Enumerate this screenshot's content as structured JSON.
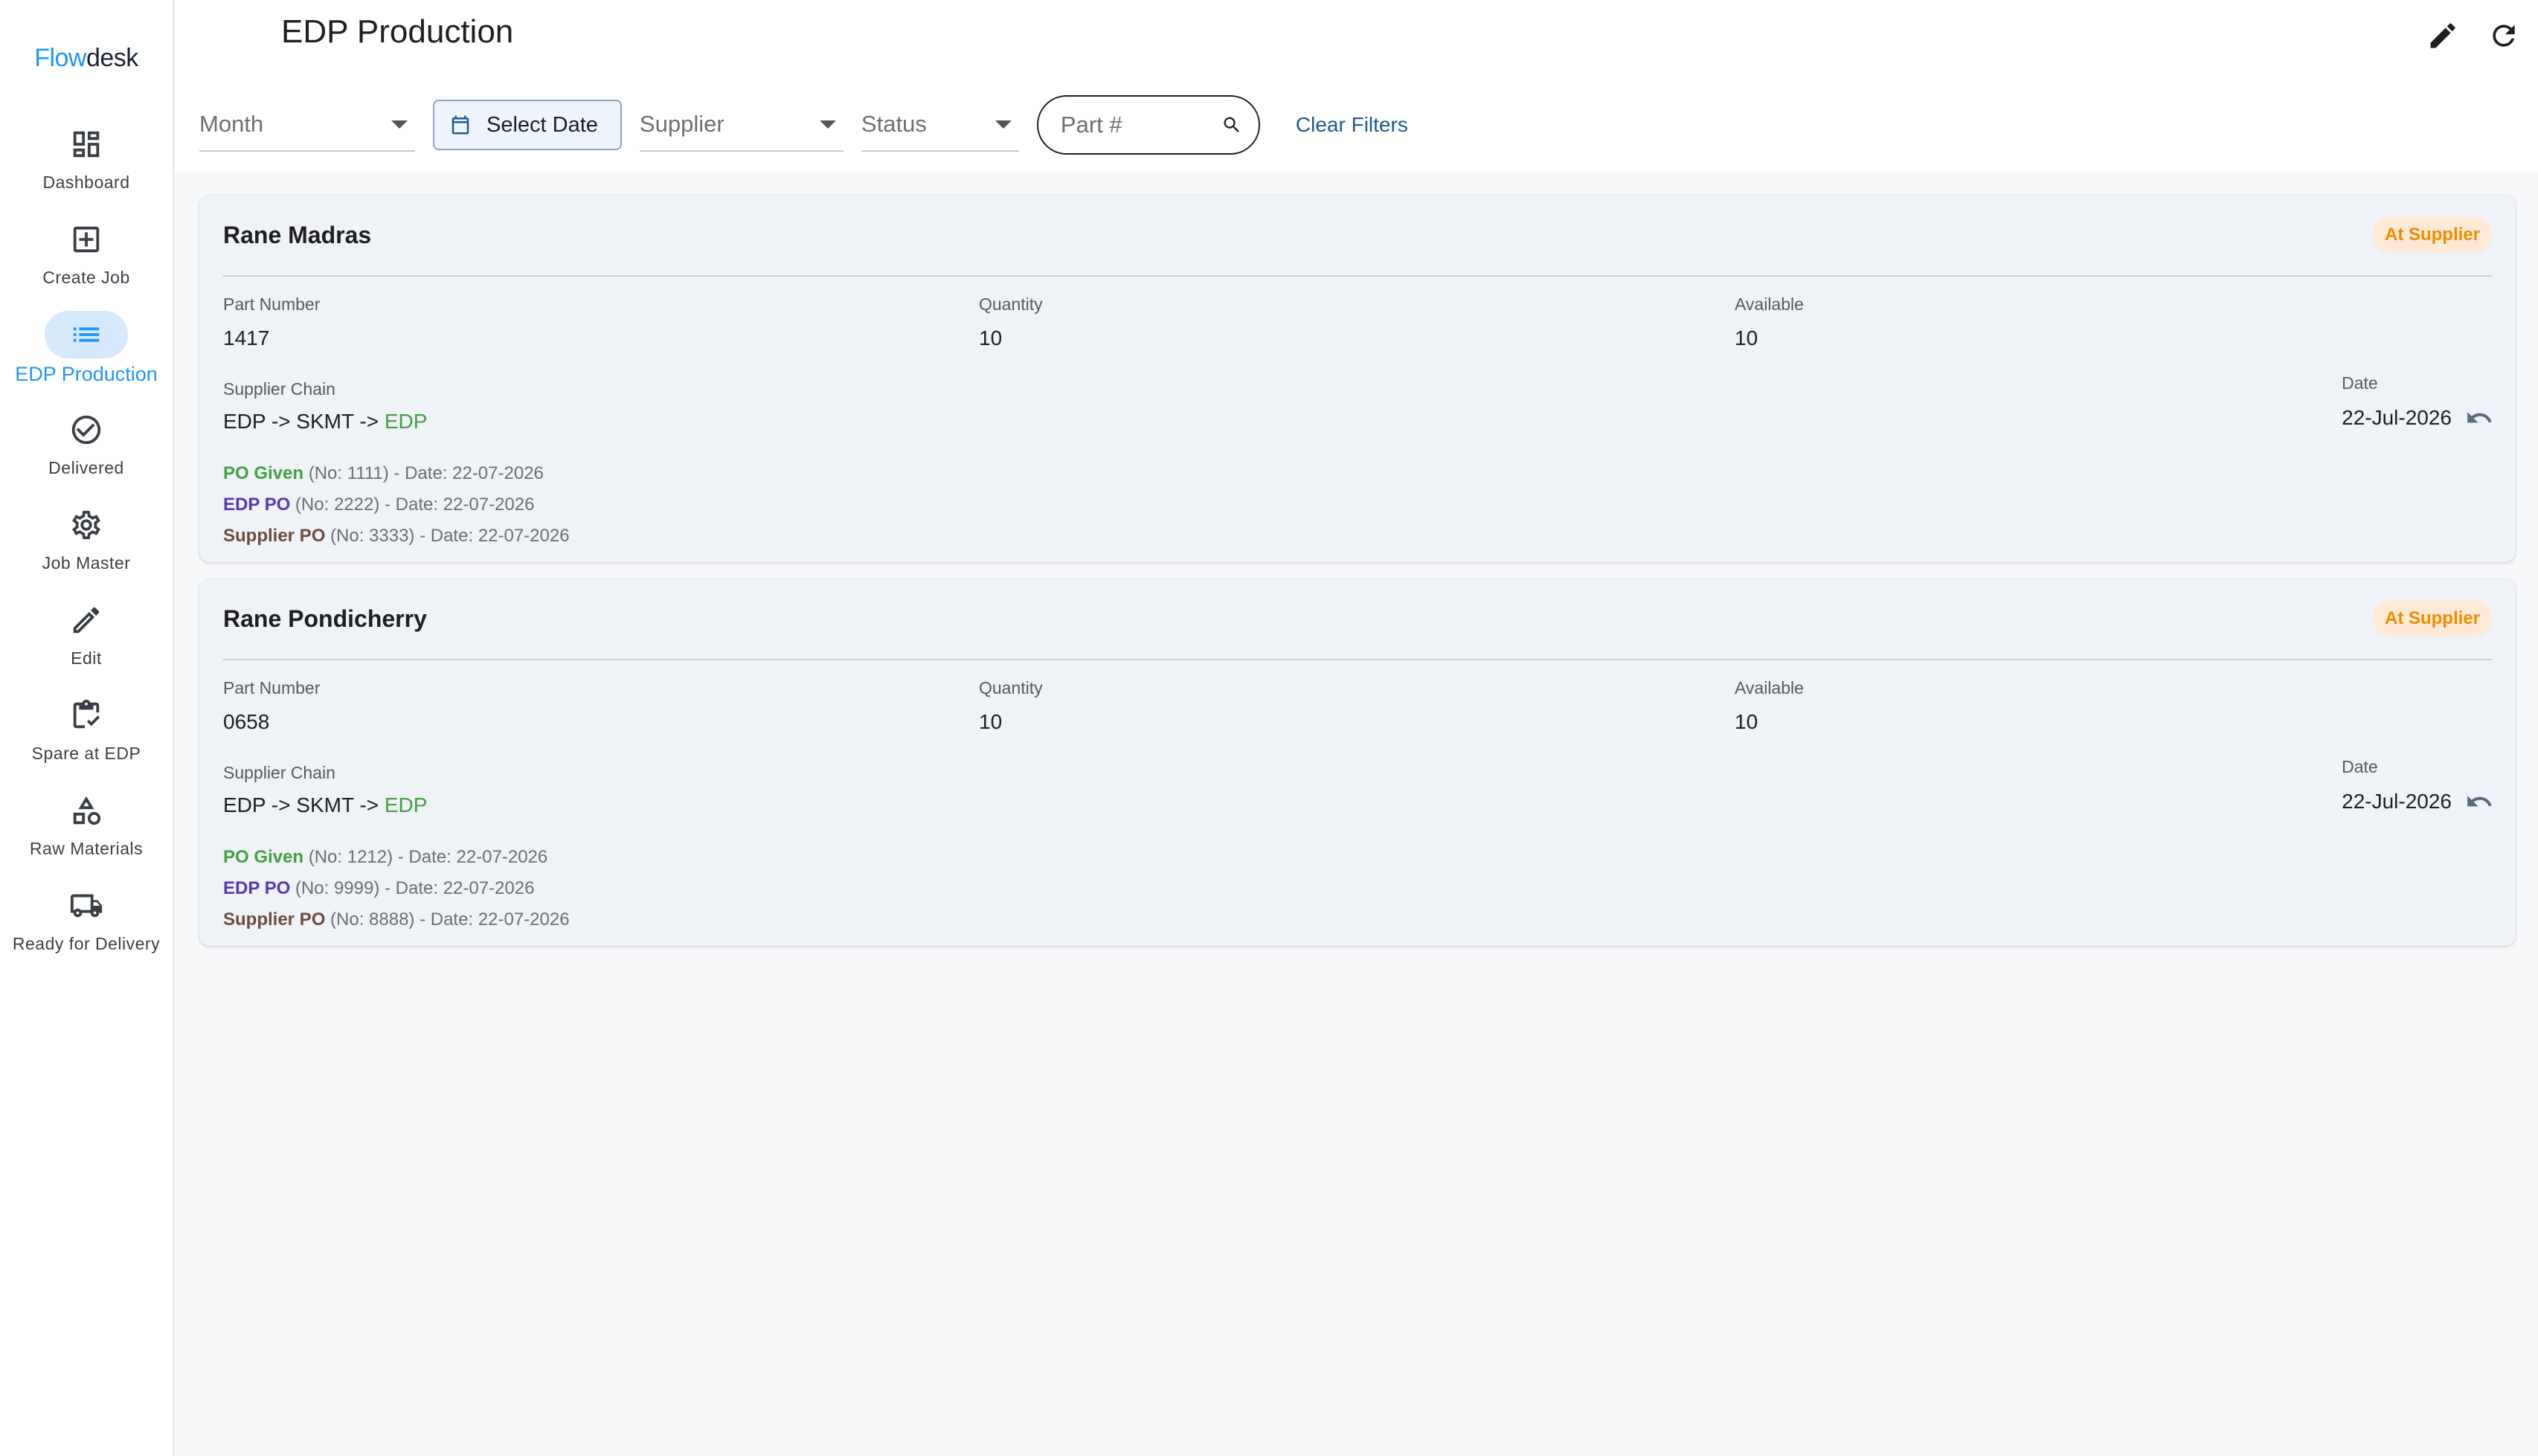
{
  "app": {
    "logo_part1": "Flow",
    "logo_part2": "desk"
  },
  "sidebar": {
    "items": [
      {
        "label": "Dashboard",
        "icon": "dashboard-icon"
      },
      {
        "label": "Create Job",
        "icon": "add-box-icon"
      },
      {
        "label": "EDP Production",
        "icon": "list-icon",
        "active": true
      },
      {
        "label": "Delivered",
        "icon": "check-circle-icon"
      },
      {
        "label": "Job Master",
        "icon": "gear-icon"
      },
      {
        "label": "Edit",
        "icon": "pencil-icon"
      },
      {
        "label": "Spare at EDP",
        "icon": "clipboard-check-icon"
      },
      {
        "label": "Raw Materials",
        "icon": "shapes-icon"
      },
      {
        "label": "Ready for Delivery",
        "icon": "truck-icon"
      }
    ]
  },
  "header": {
    "title": "EDP Production"
  },
  "filters": {
    "month_label": "Month",
    "date_label": "Select Date",
    "supplier_label": "Supplier",
    "status_label": "Status",
    "search_placeholder": "Part #",
    "clear_label": "Clear Filters"
  },
  "labels": {
    "part_number": "Part Number",
    "quantity": "Quantity",
    "available": "Available",
    "supplier_chain": "Supplier Chain",
    "date": "Date"
  },
  "cards": [
    {
      "title": "Rane Madras",
      "status": "At Supplier",
      "part_number": "1417",
      "quantity": "10",
      "available": "10",
      "chain_prefix": "EDP -> SKMT -> ",
      "chain_end": "EDP",
      "date": "22-Jul-2026",
      "po_given_key": "PO Given",
      "po_given_detail": " (No: 1111) - Date: 22-07-2026",
      "edp_po_key": "EDP PO",
      "edp_po_detail": " (No: 2222) - Date: 22-07-2026",
      "supplier_po_key": "Supplier PO",
      "supplier_po_detail": " (No: 3333) - Date: 22-07-2026"
    },
    {
      "title": "Rane Pondicherry",
      "status": "At Supplier",
      "part_number": "0658",
      "quantity": "10",
      "available": "10",
      "chain_prefix": "EDP -> SKMT -> ",
      "chain_end": "EDP",
      "date": "22-Jul-2026",
      "po_given_key": "PO Given",
      "po_given_detail": " (No: 1212) - Date: 22-07-2026",
      "edp_po_key": "EDP PO",
      "edp_po_detail": " (No: 9999) - Date: 22-07-2026",
      "supplier_po_key": "Supplier PO",
      "supplier_po_detail": " (No: 8888) - Date: 22-07-2026"
    }
  ],
  "colors": {
    "accent": "#2196f3",
    "status_orange": "#f08c00",
    "po_green": "#43a047",
    "po_purple": "#5e35b1",
    "po_brown": "#6d4c41"
  }
}
